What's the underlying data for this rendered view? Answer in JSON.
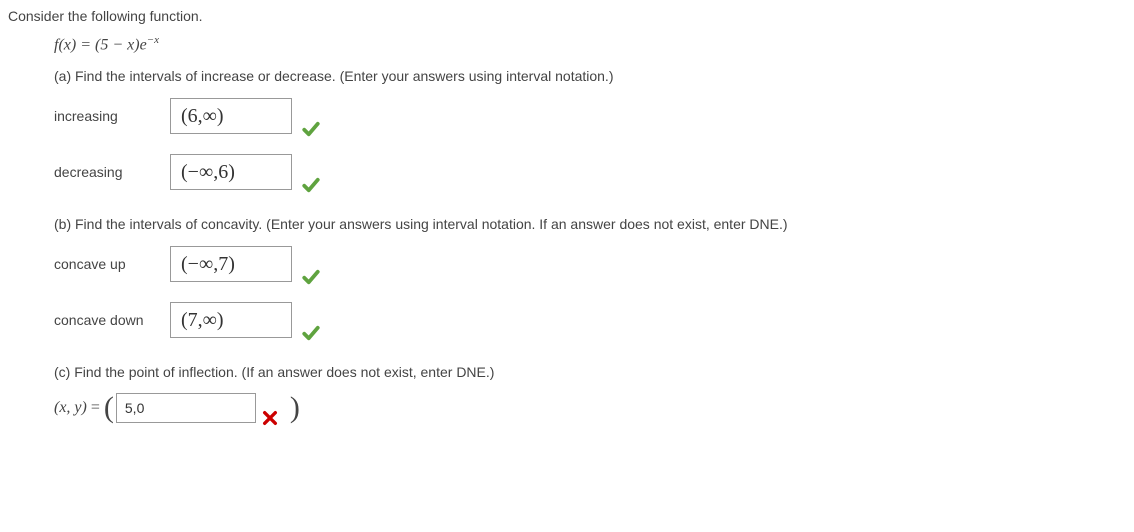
{
  "prompt": "Consider the following function.",
  "function": {
    "lhs": "f",
    "of": "x",
    "rhs_base": "(5 − x)e",
    "rhs_exp": "−x"
  },
  "partA": {
    "text": "(a) Find the intervals of increase or decrease. (Enter your answers using interval notation.)",
    "increasing": {
      "label": "increasing",
      "value": "(6,∞)"
    },
    "decreasing": {
      "label": "decreasing",
      "value": "(−∞,6)"
    }
  },
  "partB": {
    "text": "(b) Find the intervals of concavity. (Enter your answers using interval notation. If an answer does not exist, enter DNE.)",
    "concave_up": {
      "label": "concave up",
      "value": "(−∞,7)"
    },
    "concave_down": {
      "label": "concave down",
      "value": "(7,∞)"
    }
  },
  "partC": {
    "text": "(c) Find the point of inflection. (If an answer does not exist, enter DNE.)",
    "lhs": "(x, y)",
    "eq": " = ",
    "value": "5,0"
  }
}
